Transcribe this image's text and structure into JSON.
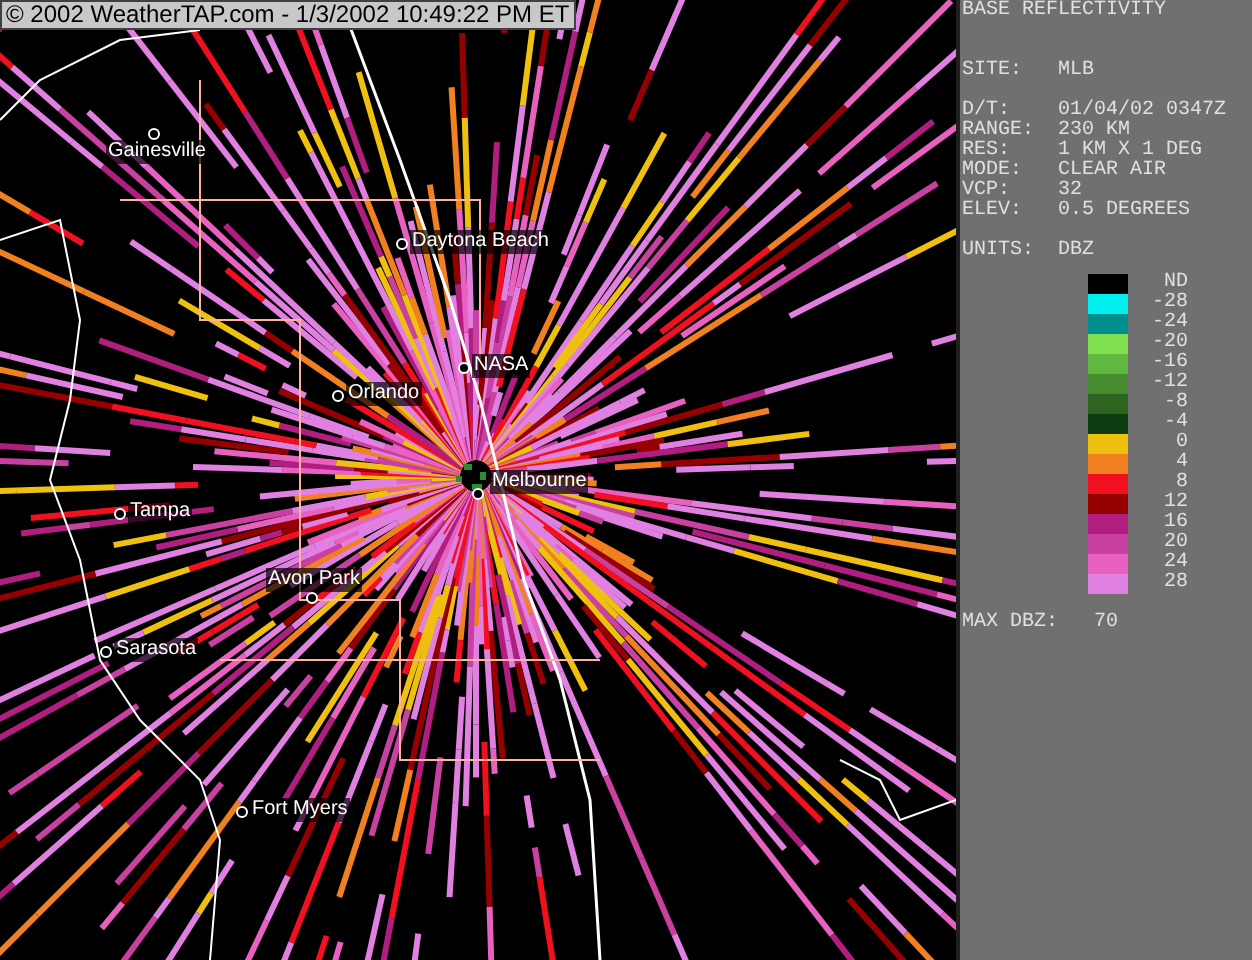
{
  "map": {
    "credit": "© 2002 WeatherTAP.com - 1/3/2002 10:49:22 PM ET",
    "cities": [
      "Gainesville",
      "Daytona Beach",
      "NASA",
      "Orlando",
      "Melbourne",
      "Tampa",
      "Avon Park",
      "Sarasota",
      "Fort Myers"
    ]
  },
  "panel": {
    "title": "BASE REFLECTIVITY",
    "site": {
      "label": "SITE:",
      "value": "MLB"
    },
    "fields": [
      {
        "label": "D/T:",
        "value": "01/04/02 0347Z"
      },
      {
        "label": "RANGE:",
        "value": "230 KM"
      },
      {
        "label": "RES:",
        "value": "1 KM X 1 DEG"
      },
      {
        "label": "MODE:",
        "value": "CLEAR AIR"
      },
      {
        "label": "VCP:",
        "value": "32"
      },
      {
        "label": "ELEV:",
        "value": "0.5 DEGREES"
      }
    ],
    "units": {
      "label": "UNITS:",
      "value": "DBZ"
    },
    "legend": [
      {
        "label": "ND",
        "color": "#000000"
      },
      {
        "label": "-28",
        "color": "#00f0f0"
      },
      {
        "label": "-24",
        "color": "#008f8f"
      },
      {
        "label": "-20",
        "color": "#80e050"
      },
      {
        "label": "-16",
        "color": "#60b840"
      },
      {
        "label": "-12",
        "color": "#488c30"
      },
      {
        "label": "-8",
        "color": "#2c6420"
      },
      {
        "label": "-4",
        "color": "#0c3c10"
      },
      {
        "label": "0",
        "color": "#f0c010"
      },
      {
        "label": "4",
        "color": "#f08020"
      },
      {
        "label": "8",
        "color": "#f01020"
      },
      {
        "label": "12",
        "color": "#960000"
      },
      {
        "label": "16",
        "color": "#b01e80"
      },
      {
        "label": "20",
        "color": "#c840a0"
      },
      {
        "label": "24",
        "color": "#e860c0"
      },
      {
        "label": "28",
        "color": "#e080e0"
      }
    ],
    "max": {
      "label": "MAX DBZ:",
      "value": "70"
    }
  }
}
